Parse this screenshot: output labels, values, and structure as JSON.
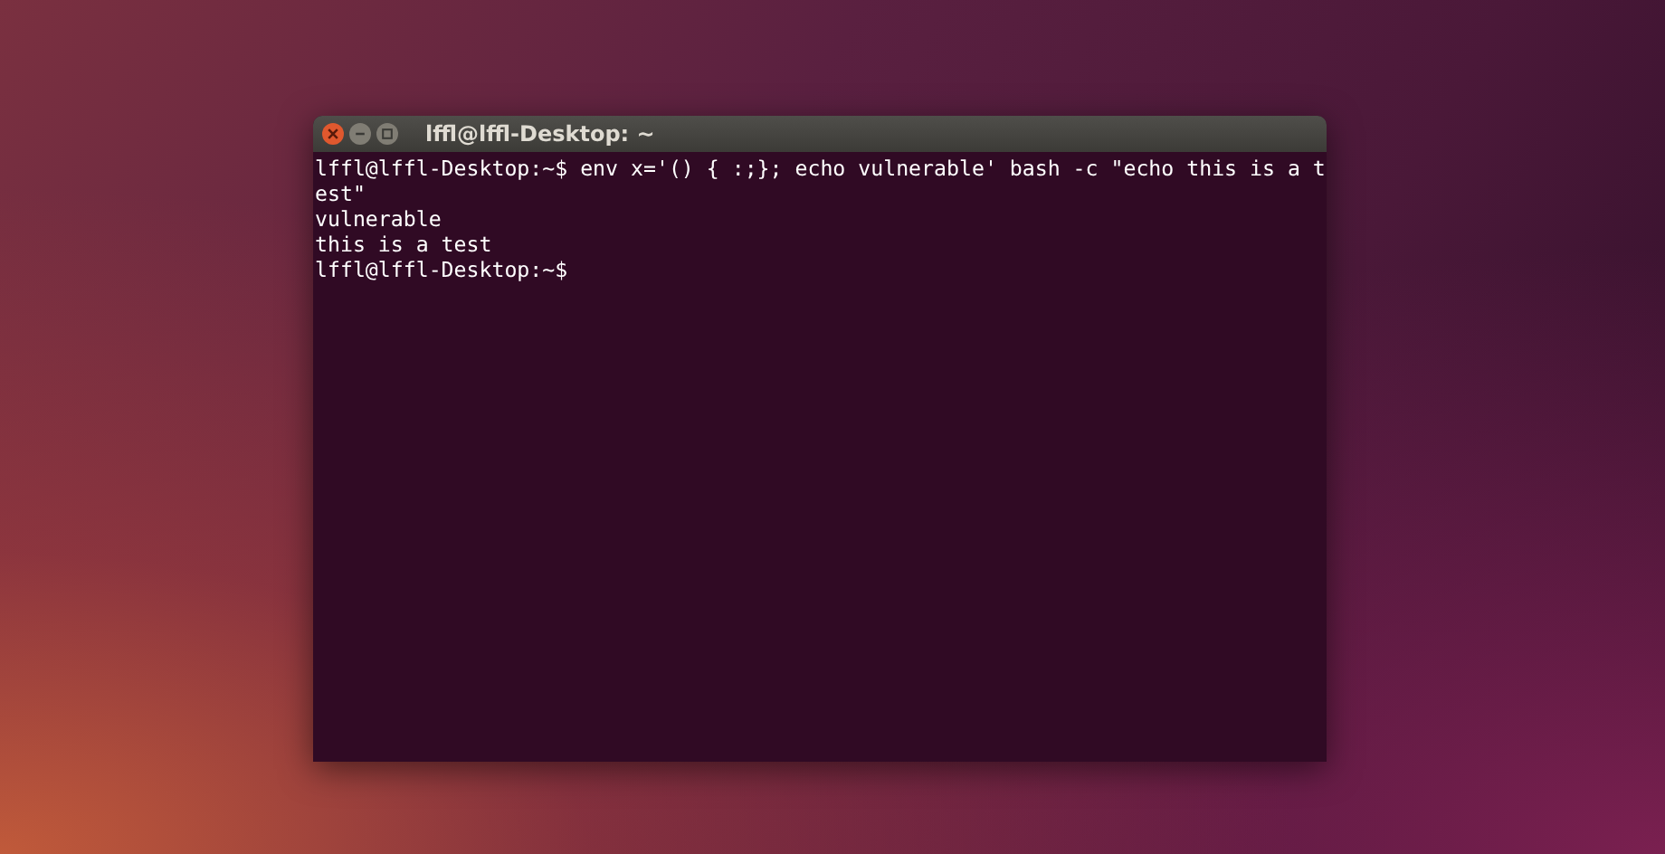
{
  "window": {
    "title": "lffl@lffl-Desktop: ~"
  },
  "terminal": {
    "lines": [
      "lffl@lffl-Desktop:~$ env x='() { :;}; echo vulnerable' bash -c \"echo this is a t",
      "est\"",
      "vulnerable",
      "this is a test",
      "lffl@lffl-Desktop:~$"
    ]
  }
}
